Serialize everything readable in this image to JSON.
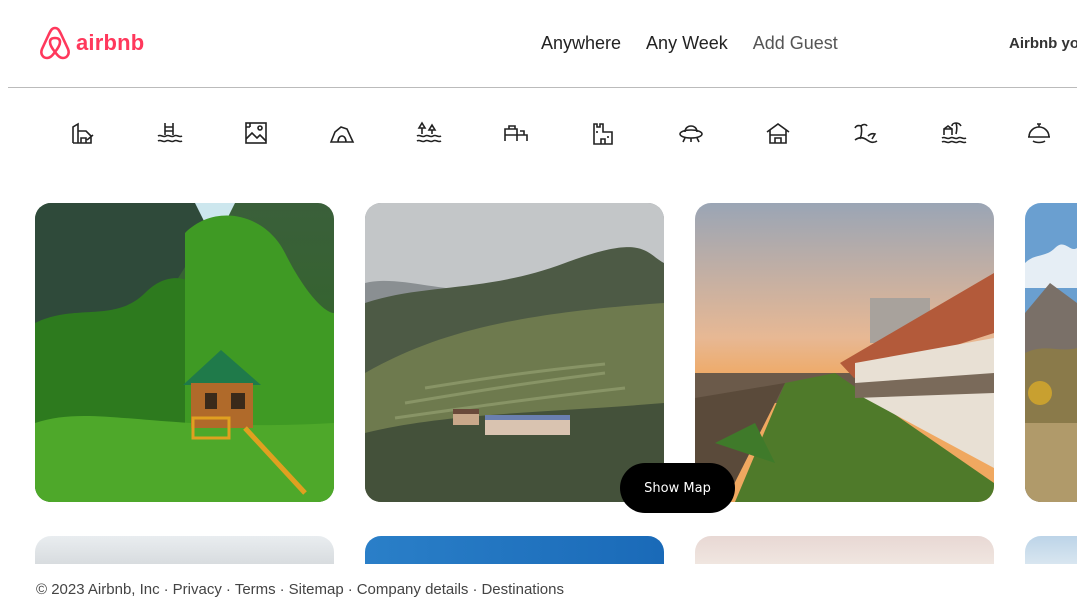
{
  "brand": {
    "name": "airbnb",
    "color": "#FF385C"
  },
  "search": {
    "where": "Anywhere",
    "when": "Any Week",
    "guests": "Add Guest"
  },
  "header": {
    "host_link": "Airbnb yo"
  },
  "categories": [
    "cabins-icon",
    "beachfront-icon",
    "amazing-views-icon",
    "caves-icon",
    "lakefront-icon",
    "rooms-icon",
    "castles-icon",
    "omg-icon",
    "cottages-icon",
    "tropical-icon",
    "islands-icon",
    "chefs-kitchen-icon"
  ],
  "listings": [
    {
      "image": "treehouse-forest-image"
    },
    {
      "image": "misty-hillside-terraces-image"
    },
    {
      "image": "sunset-resort-lawn-image"
    },
    {
      "image": "mountain-valley-image"
    }
  ],
  "map_button": {
    "label": "Show Map"
  },
  "footer": {
    "copyright": "© 2023 Airbnb, Inc",
    "links": [
      "Privacy",
      "Terms",
      "Sitemap",
      "Company details",
      "Destinations"
    ]
  }
}
